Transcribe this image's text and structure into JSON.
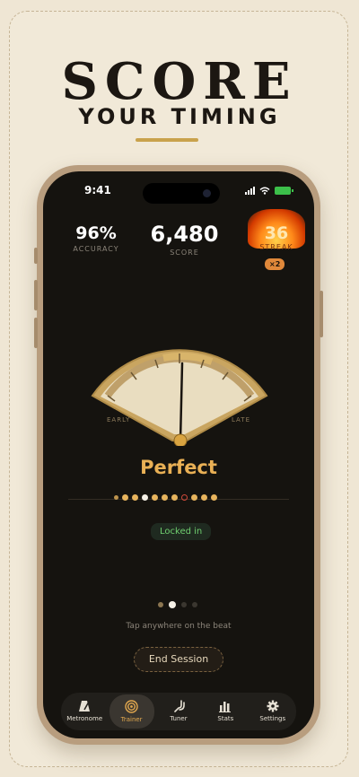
{
  "headline": {
    "line1": "SCORE",
    "line2": "YOUR TIMING"
  },
  "status_bar": {
    "time": "9:41"
  },
  "stats": {
    "accuracy": {
      "value": "96%",
      "label": "ACCURACY"
    },
    "score": {
      "value": "6,480",
      "label": "SCORE"
    },
    "streak": {
      "value": "36",
      "label": "STREAK",
      "multiplier": "×2"
    }
  },
  "gauge": {
    "early_label": "EARLY",
    "late_label": "LATE"
  },
  "result": "Perfect",
  "locked_badge": "Locked in",
  "hint": "Tap anywhere on the beat",
  "end_button": "End Session",
  "tabs": [
    {
      "label": "Metronome",
      "icon": "metronome-icon"
    },
    {
      "label": "Trainer",
      "icon": "target-icon",
      "active": true
    },
    {
      "label": "Tuner",
      "icon": "tuning-fork-icon"
    },
    {
      "label": "Stats",
      "icon": "bar-chart-icon"
    },
    {
      "label": "Settings",
      "icon": "gear-icon"
    }
  ],
  "colors": {
    "accent": "#e9b055",
    "background": "#efe6d4",
    "screen": "#15130f",
    "success": "#6fcf6f"
  }
}
